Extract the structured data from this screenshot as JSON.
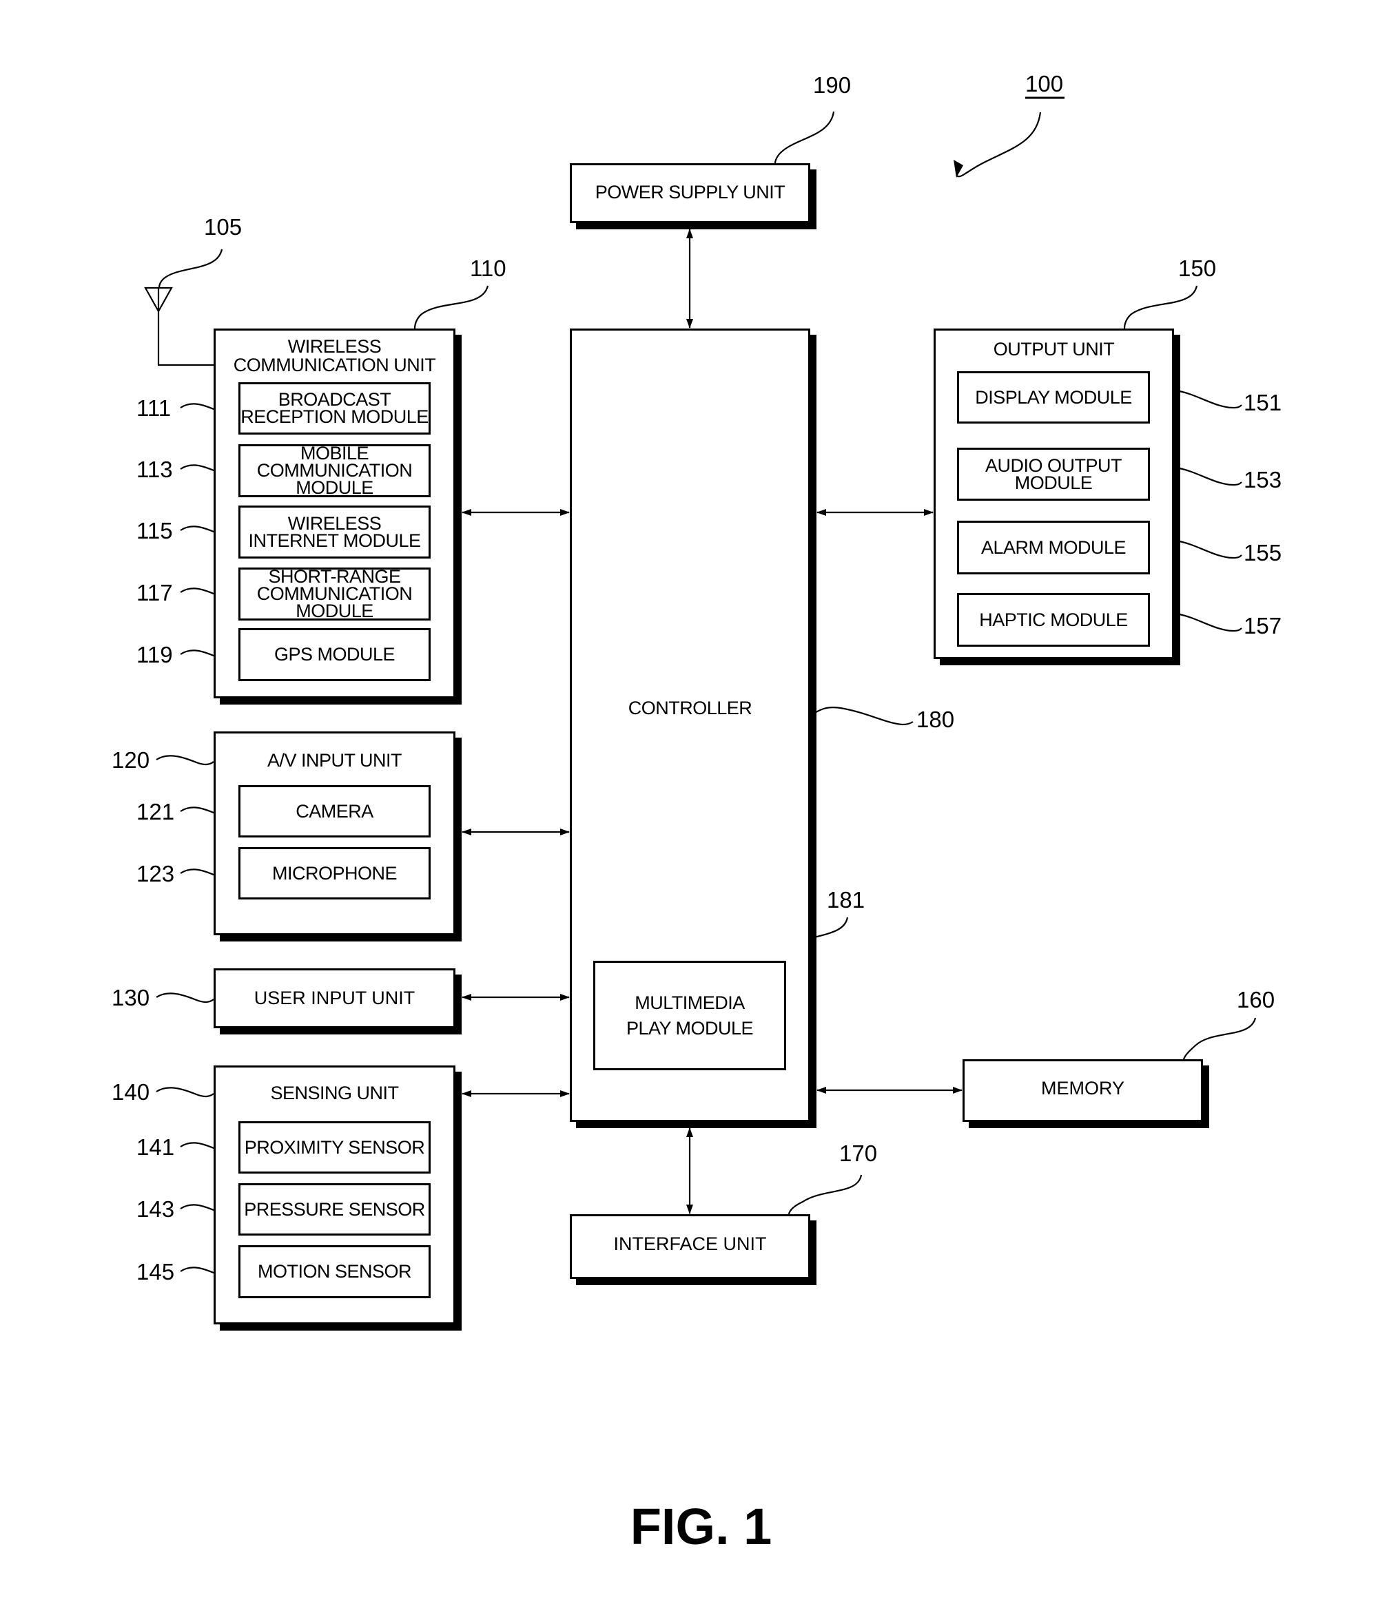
{
  "figure": {
    "caption": "FIG. 1",
    "device_ref": "100"
  },
  "antenna": {
    "ref": "105"
  },
  "wireless_unit": {
    "ref": "110",
    "title": "WIRELESS\nCOMMUNICATION UNIT",
    "modules": [
      {
        "ref": "111",
        "label": "BROADCAST\nRECEPTION MODULE"
      },
      {
        "ref": "113",
        "label": "MOBILE\nCOMMUNICATION\nMODULE"
      },
      {
        "ref": "115",
        "label": "WIRELESS\nINTERNET MODULE"
      },
      {
        "ref": "117",
        "label": "SHORT-RANGE\nCOMMUNICATION\nMODULE"
      },
      {
        "ref": "119",
        "label": "GPS MODULE"
      }
    ]
  },
  "av_input_unit": {
    "ref": "120",
    "title": "A/V INPUT UNIT",
    "modules": [
      {
        "ref": "121",
        "label": "CAMERA"
      },
      {
        "ref": "123",
        "label": "MICROPHONE"
      }
    ]
  },
  "user_input_unit": {
    "ref": "130",
    "title": "USER INPUT UNIT"
  },
  "sensing_unit": {
    "ref": "140",
    "title": "SENSING UNIT",
    "modules": [
      {
        "ref": "141",
        "label": "PROXIMITY SENSOR"
      },
      {
        "ref": "143",
        "label": "PRESSURE SENSOR"
      },
      {
        "ref": "145",
        "label": "MOTION SENSOR"
      }
    ]
  },
  "output_unit": {
    "ref": "150",
    "title": "OUTPUT UNIT",
    "modules": [
      {
        "ref": "151",
        "label": "DISPLAY MODULE"
      },
      {
        "ref": "153",
        "label": "AUDIO OUTPUT\nMODULE"
      },
      {
        "ref": "155",
        "label": "ALARM MODULE"
      },
      {
        "ref": "157",
        "label": "HAPTIC MODULE"
      }
    ]
  },
  "memory": {
    "ref": "160",
    "title": "MEMORY"
  },
  "interface_unit": {
    "ref": "170",
    "title": "INTERFACE UNIT"
  },
  "controller": {
    "ref": "180",
    "title": "CONTROLLER",
    "multimedia_module": {
      "ref": "181",
      "label": "MULTIMEDIA\nPLAY MODULE"
    }
  },
  "power_supply_unit": {
    "ref": "190",
    "title": "POWER SUPPLY UNIT"
  }
}
